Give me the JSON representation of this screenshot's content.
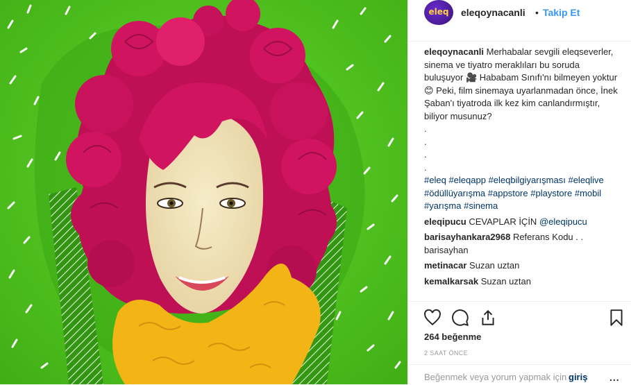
{
  "post": {
    "username": "eleqoynacanli",
    "avatar_text": "eleq",
    "follow_label": "Takip Et",
    "separator": "•"
  },
  "caption": {
    "username": "eleqoynacanli",
    "text": "Merhabalar sevgili eleqseverler, sinema ve tiyatro meraklıları bu soruda buluşuyor 🎥 Hababam Sınıfı'nı bilmeyen yoktur 😊 Peki, film sinemaya uyarlanmadan önce, İnek Şaban'ı tiyatroda ilk kez kim canlandırmıştır, biliyor musunuz?",
    "dots": [
      ".",
      ".",
      ".",
      "."
    ],
    "hashtags": [
      "#eleq",
      "#eleqapp",
      "#eleqbilgiyarışması",
      "#eleqlive",
      "#ödüllüyarışma",
      "#appstore",
      "#playstore",
      "#mobil",
      "#yarışma",
      "#sinema"
    ]
  },
  "comments": [
    {
      "user": "eleqipucu",
      "text": "CEVAPLAR İÇİN ",
      "mention": "@eleqipucu"
    },
    {
      "user": "barisayhankara2968",
      "text": "Referans Kodu . . barisayhan",
      "mention": ""
    },
    {
      "user": "metinacar",
      "text": "Suzan uztan",
      "mention": ""
    },
    {
      "user": "kemalkarsak",
      "text": "Suzan uztan",
      "mention": ""
    }
  ],
  "likes_label": "264 beğenme",
  "time_label": "2 SAAT ÖNCE",
  "add_comment": {
    "placeholder": "Beğenmek veya yorum yapmak için",
    "login_label": "giriş",
    "more_label": "..."
  },
  "icons": {
    "like": "heart-icon",
    "comment": "comment-icon",
    "share": "share-icon",
    "save": "bookmark-icon"
  },
  "colors": {
    "background_green": "#4cbf1d",
    "hair_magenta": "#d0145f",
    "scarf_yellow": "#f2b515",
    "link_blue": "#3897f0",
    "hashtag_blue": "#003569"
  }
}
